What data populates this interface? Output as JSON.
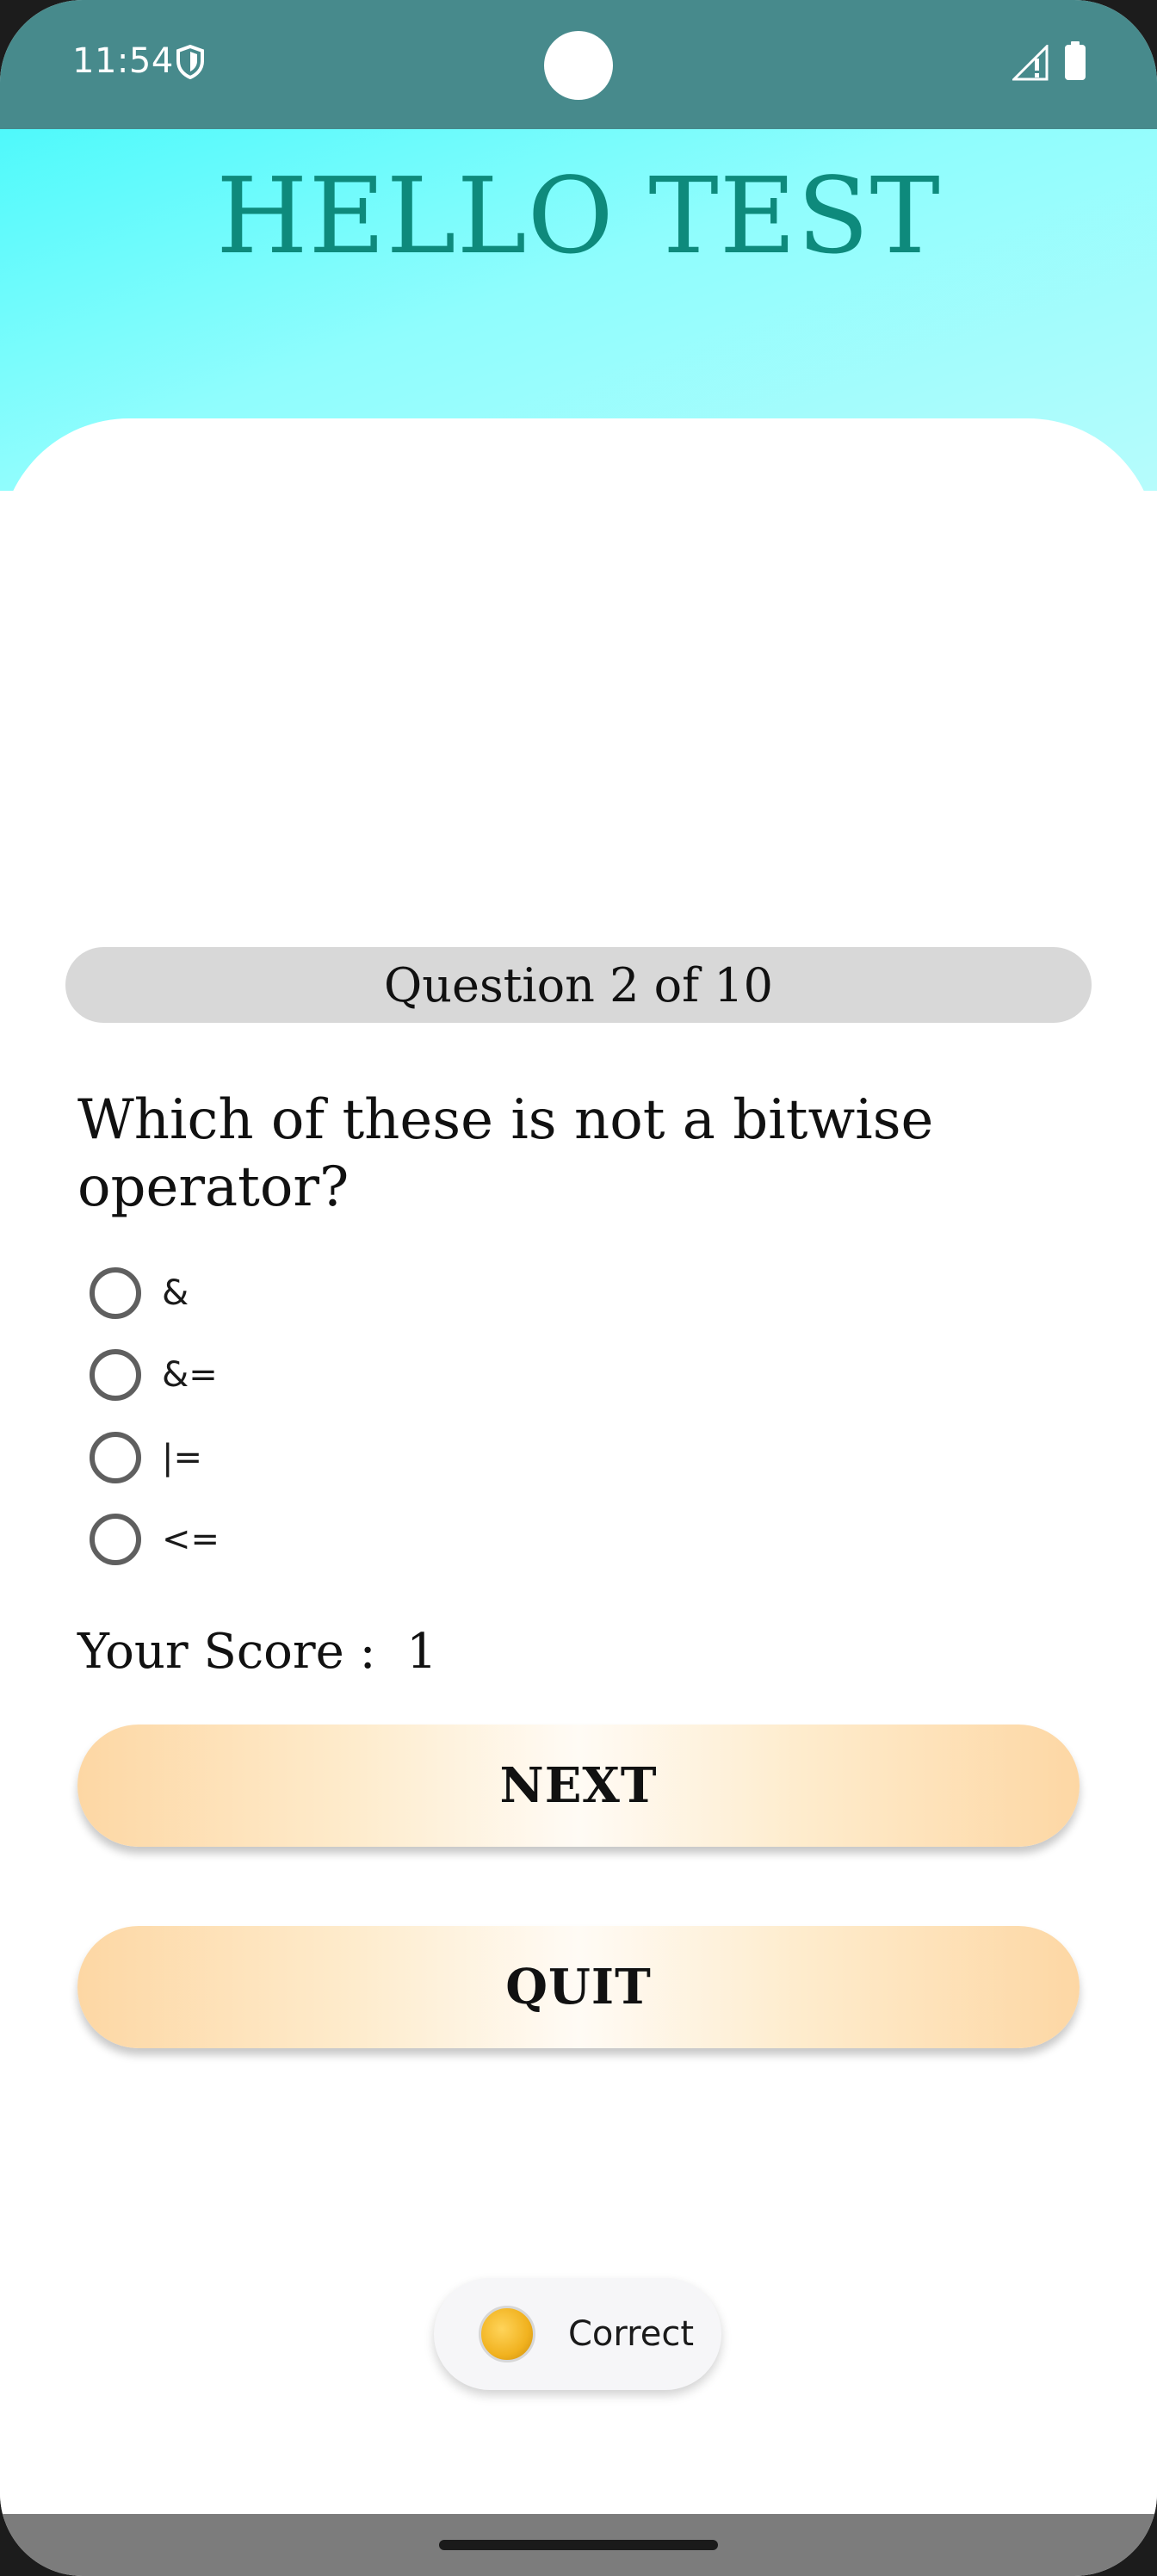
{
  "status_bar": {
    "time": "11:54",
    "icons": [
      "shield-icon",
      "signal-icon",
      "battery-icon"
    ]
  },
  "header": {
    "title": "HELLO TEST"
  },
  "quiz": {
    "counter": "Question 2 of 10",
    "question": "Which of these is not a bitwise operator?",
    "options": [
      {
        "label": "&",
        "selected": false
      },
      {
        "label": "&=",
        "selected": false
      },
      {
        "label": "|=",
        "selected": false
      },
      {
        "label": "<=",
        "selected": false
      }
    ],
    "score_label": "Your Score :",
    "score_value": "1"
  },
  "buttons": {
    "next_label": "NEXT",
    "quit_label": "QUIT"
  },
  "toast": {
    "text": "Correct",
    "icon": "coin-icon"
  },
  "colors": {
    "title": "#0e8a7c",
    "status_bar": "#478a8c",
    "button_edge": "#fdd7a4"
  }
}
